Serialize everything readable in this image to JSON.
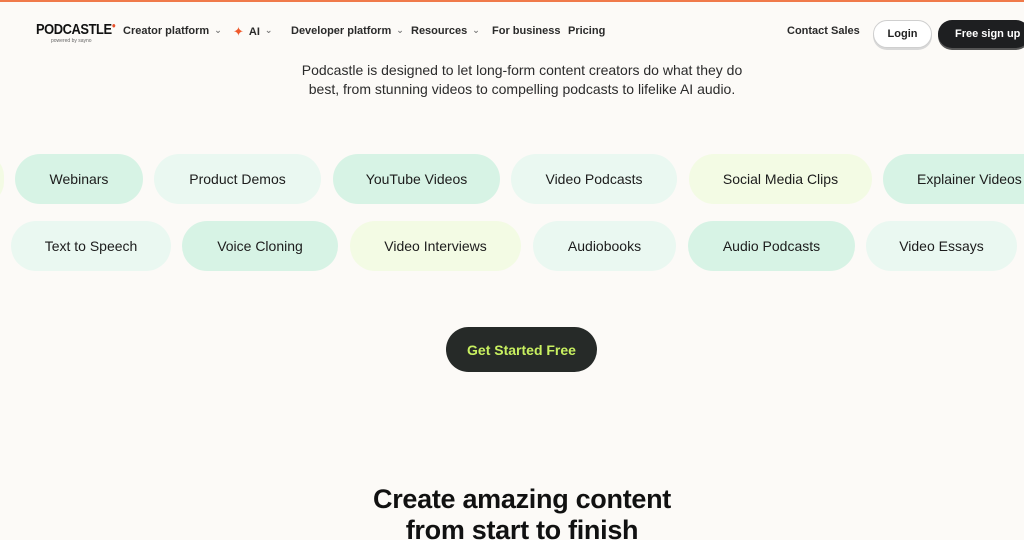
{
  "brand": {
    "name": "PODCASTLE",
    "tagline": "powered by sayno"
  },
  "nav": {
    "creator_platform": "Creator platform",
    "ai": "AI",
    "developer_platform": "Developer platform",
    "resources": "Resources",
    "for_business": "For business",
    "pricing": "Pricing",
    "contact_sales": "Contact Sales",
    "login": "Login",
    "signup": "Free sign up"
  },
  "intro": {
    "line1": "Podcastle is designed to let long-form content creators do what they do",
    "line2": "best, from stunning videos to compelling podcasts to lifelike AI audio."
  },
  "chips_row1": [
    "Webinars",
    "Product Demos",
    "YouTube Videos",
    "Video Podcasts",
    "Social Media Clips",
    "Explainer Videos"
  ],
  "chips_row2": [
    "Text to Speech",
    "Voice Cloning",
    "Video Interviews",
    "Audiobooks",
    "Audio Podcasts",
    "Video Essays"
  ],
  "cta": {
    "label": "Get Started Free"
  },
  "section": {
    "title_line1": "Create amazing content",
    "title_line2": "from start to finish"
  },
  "colors": {
    "accent": "#f07a4a",
    "cta_text": "#c8f060",
    "dark": "#1e1f21",
    "chip_mint": "#d7f3e5",
    "chip_pale": "#eaf8f1",
    "chip_lime": "#f3fbe4"
  }
}
